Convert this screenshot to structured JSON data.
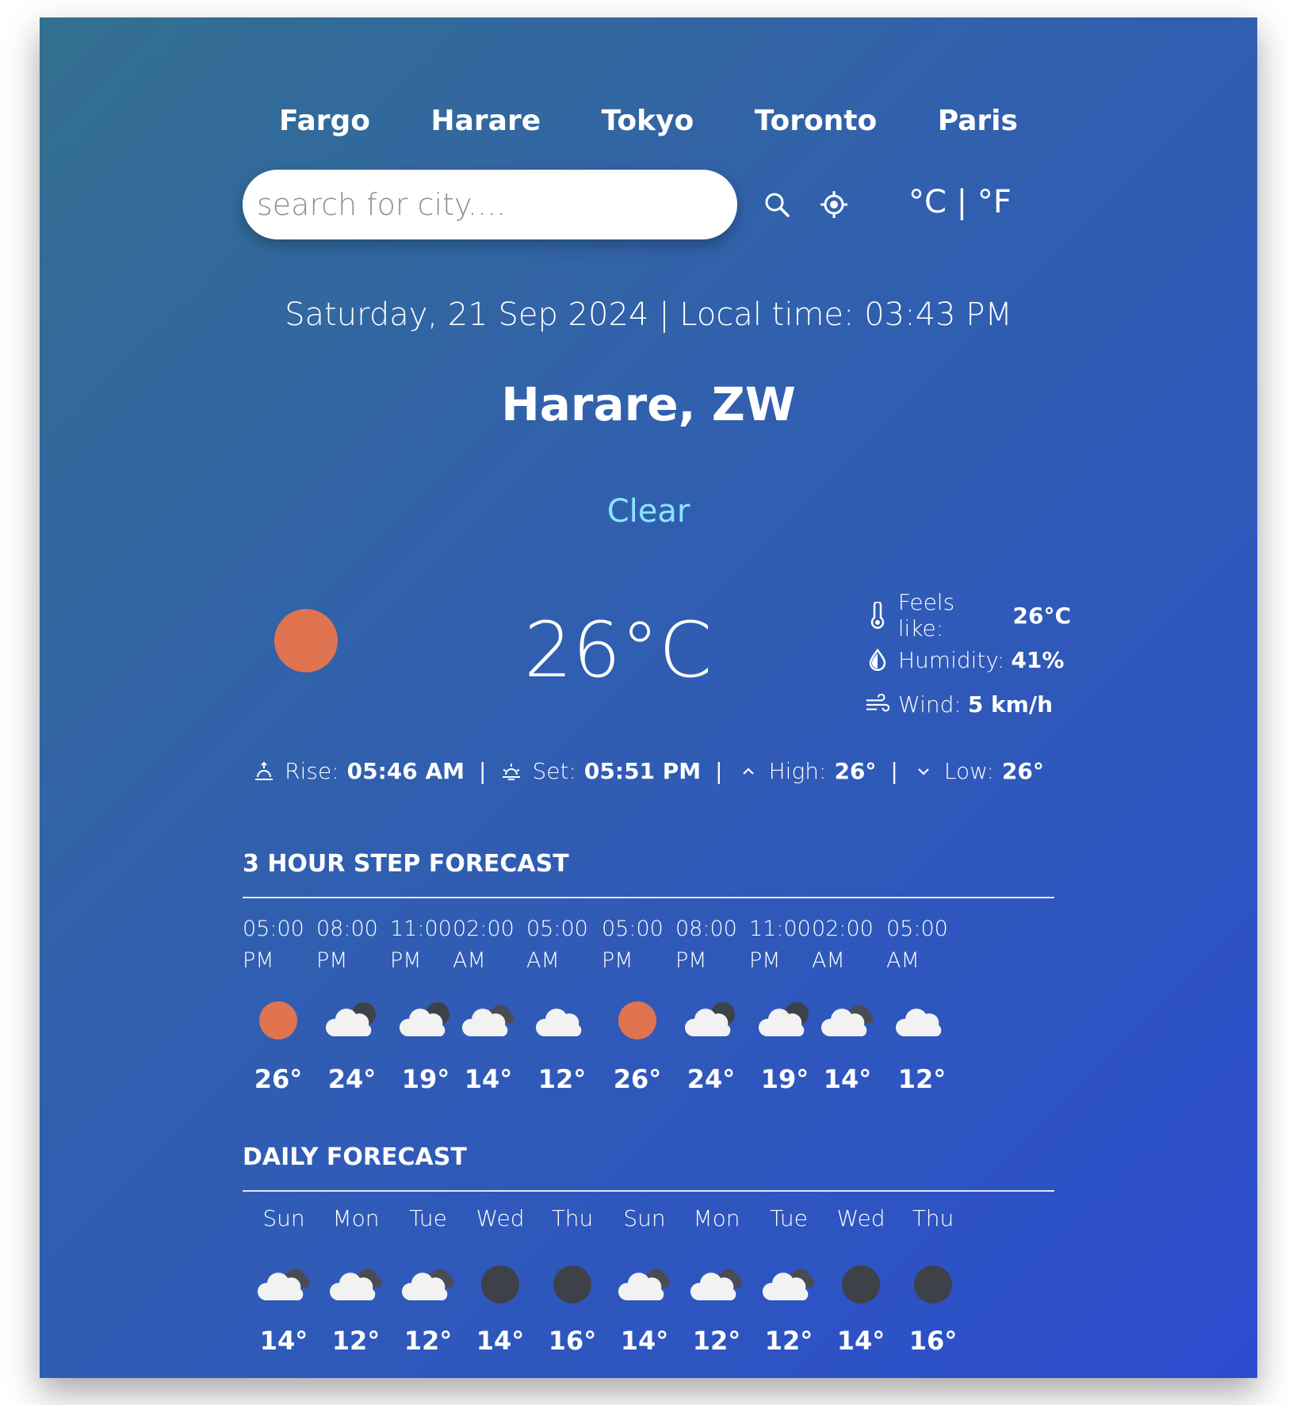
{
  "cities": [
    "Fargo",
    "Harare",
    "Tokyo",
    "Toronto",
    "Paris"
  ],
  "search": {
    "placeholder": "search for city...."
  },
  "icons": {
    "search": "search-icon",
    "locate": "location-target-icon"
  },
  "units": {
    "celsius": "°C",
    "separator": "|",
    "fahrenheit": "°F"
  },
  "datetime": "Saturday, 21 Sep 2024 | Local time: 03:43 PM",
  "location": "Harare, ZW",
  "condition": "Clear",
  "condition_color": "#8ae6ff",
  "current": {
    "temp": "26°C",
    "icon": "sun-icon",
    "feels_label": "Feels like:",
    "feels_value": "26°C",
    "humidity_label": "Humidity:",
    "humidity_value": "41%",
    "wind_label": "Wind:",
    "wind_value": "5 km/h"
  },
  "summary": {
    "rise_label": "Rise:",
    "rise_value": "05:46 AM",
    "set_label": "Set:",
    "set_value": "05:51 PM",
    "high_label": "High:",
    "high_value": "26°",
    "low_label": "Low:",
    "low_value": "26°",
    "separator": "|"
  },
  "hourly": {
    "title": "3 HOUR STEP FORECAST",
    "items": [
      {
        "time": "05:00 PM",
        "icon": "sun-icon",
        "temp": "26°"
      },
      {
        "time": "08:00 PM",
        "icon": "cloud-night-icon",
        "temp": "24°"
      },
      {
        "time": "11:00 PM",
        "icon": "cloud-night-icon",
        "temp": "19°"
      },
      {
        "time": "02:00 AM",
        "icon": "broken-clouds-icon",
        "temp": "14°"
      },
      {
        "time": "05:00 AM",
        "icon": "cloud-icon",
        "temp": "12°"
      },
      {
        "time": "05:00 PM",
        "icon": "sun-icon",
        "temp": "26°"
      },
      {
        "time": "08:00 PM",
        "icon": "cloud-night-icon",
        "temp": "24°"
      },
      {
        "time": "11:00 PM",
        "icon": "cloud-night-icon",
        "temp": "19°"
      },
      {
        "time": "02:00 AM",
        "icon": "broken-clouds-icon",
        "temp": "14°"
      },
      {
        "time": "05:00 AM",
        "icon": "cloud-icon",
        "temp": "12°"
      }
    ]
  },
  "daily": {
    "title": "DAILY FORECAST",
    "items": [
      {
        "day": "Sun",
        "icon": "broken-clouds-icon",
        "temp": "14°"
      },
      {
        "day": "Mon",
        "icon": "broken-clouds-icon",
        "temp": "12°"
      },
      {
        "day": "Tue",
        "icon": "broken-clouds-icon",
        "temp": "12°"
      },
      {
        "day": "Wed",
        "icon": "moon-icon",
        "temp": "14°"
      },
      {
        "day": "Thu",
        "icon": "moon-icon",
        "temp": "16°"
      },
      {
        "day": "Sun",
        "icon": "broken-clouds-icon",
        "temp": "14°"
      },
      {
        "day": "Mon",
        "icon": "broken-clouds-icon",
        "temp": "12°"
      },
      {
        "day": "Tue",
        "icon": "broken-clouds-icon",
        "temp": "12°"
      },
      {
        "day": "Wed",
        "icon": "moon-icon",
        "temp": "14°"
      },
      {
        "day": "Thu",
        "icon": "moon-icon",
        "temp": "16°"
      }
    ]
  }
}
